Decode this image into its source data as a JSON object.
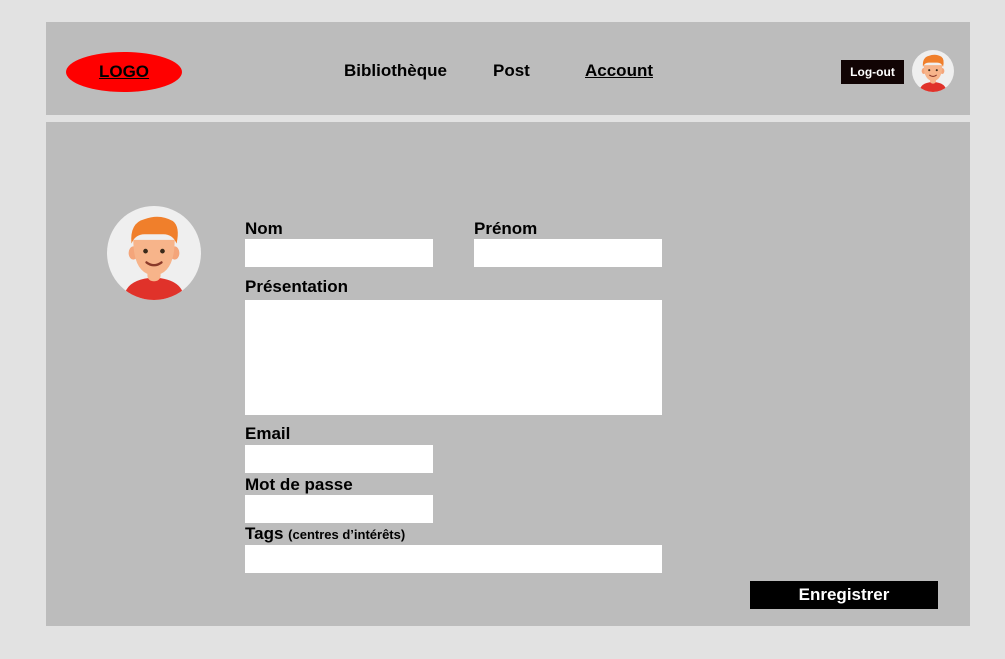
{
  "header": {
    "logo_label": "LOGO",
    "nav": [
      {
        "label": "Bibliothèque",
        "active": false
      },
      {
        "label": "Post",
        "active": false
      },
      {
        "label": "Account",
        "active": true
      }
    ],
    "logout_label": "Log-out",
    "avatar_icon": "user-avatar-icon"
  },
  "colors": {
    "page_background": "#e2e2e2",
    "panel_background": "#bcbcbc",
    "logo": "#ff0000",
    "button": "#000000",
    "input": "#ffffff"
  },
  "form": {
    "avatar_icon": "user-avatar-icon",
    "nom_label": "Nom",
    "nom_value": "",
    "prenom_label": "Prénom",
    "prenom_value": "",
    "presentation_label": "Présentation",
    "presentation_value": "",
    "email_label": "Email",
    "email_value": "",
    "password_label": "Mot de passe",
    "password_value": "",
    "tags_label": "Tags",
    "tags_hint": "(centres d’intérêts)",
    "tags_value": "",
    "save_label": "Enregistrer"
  }
}
